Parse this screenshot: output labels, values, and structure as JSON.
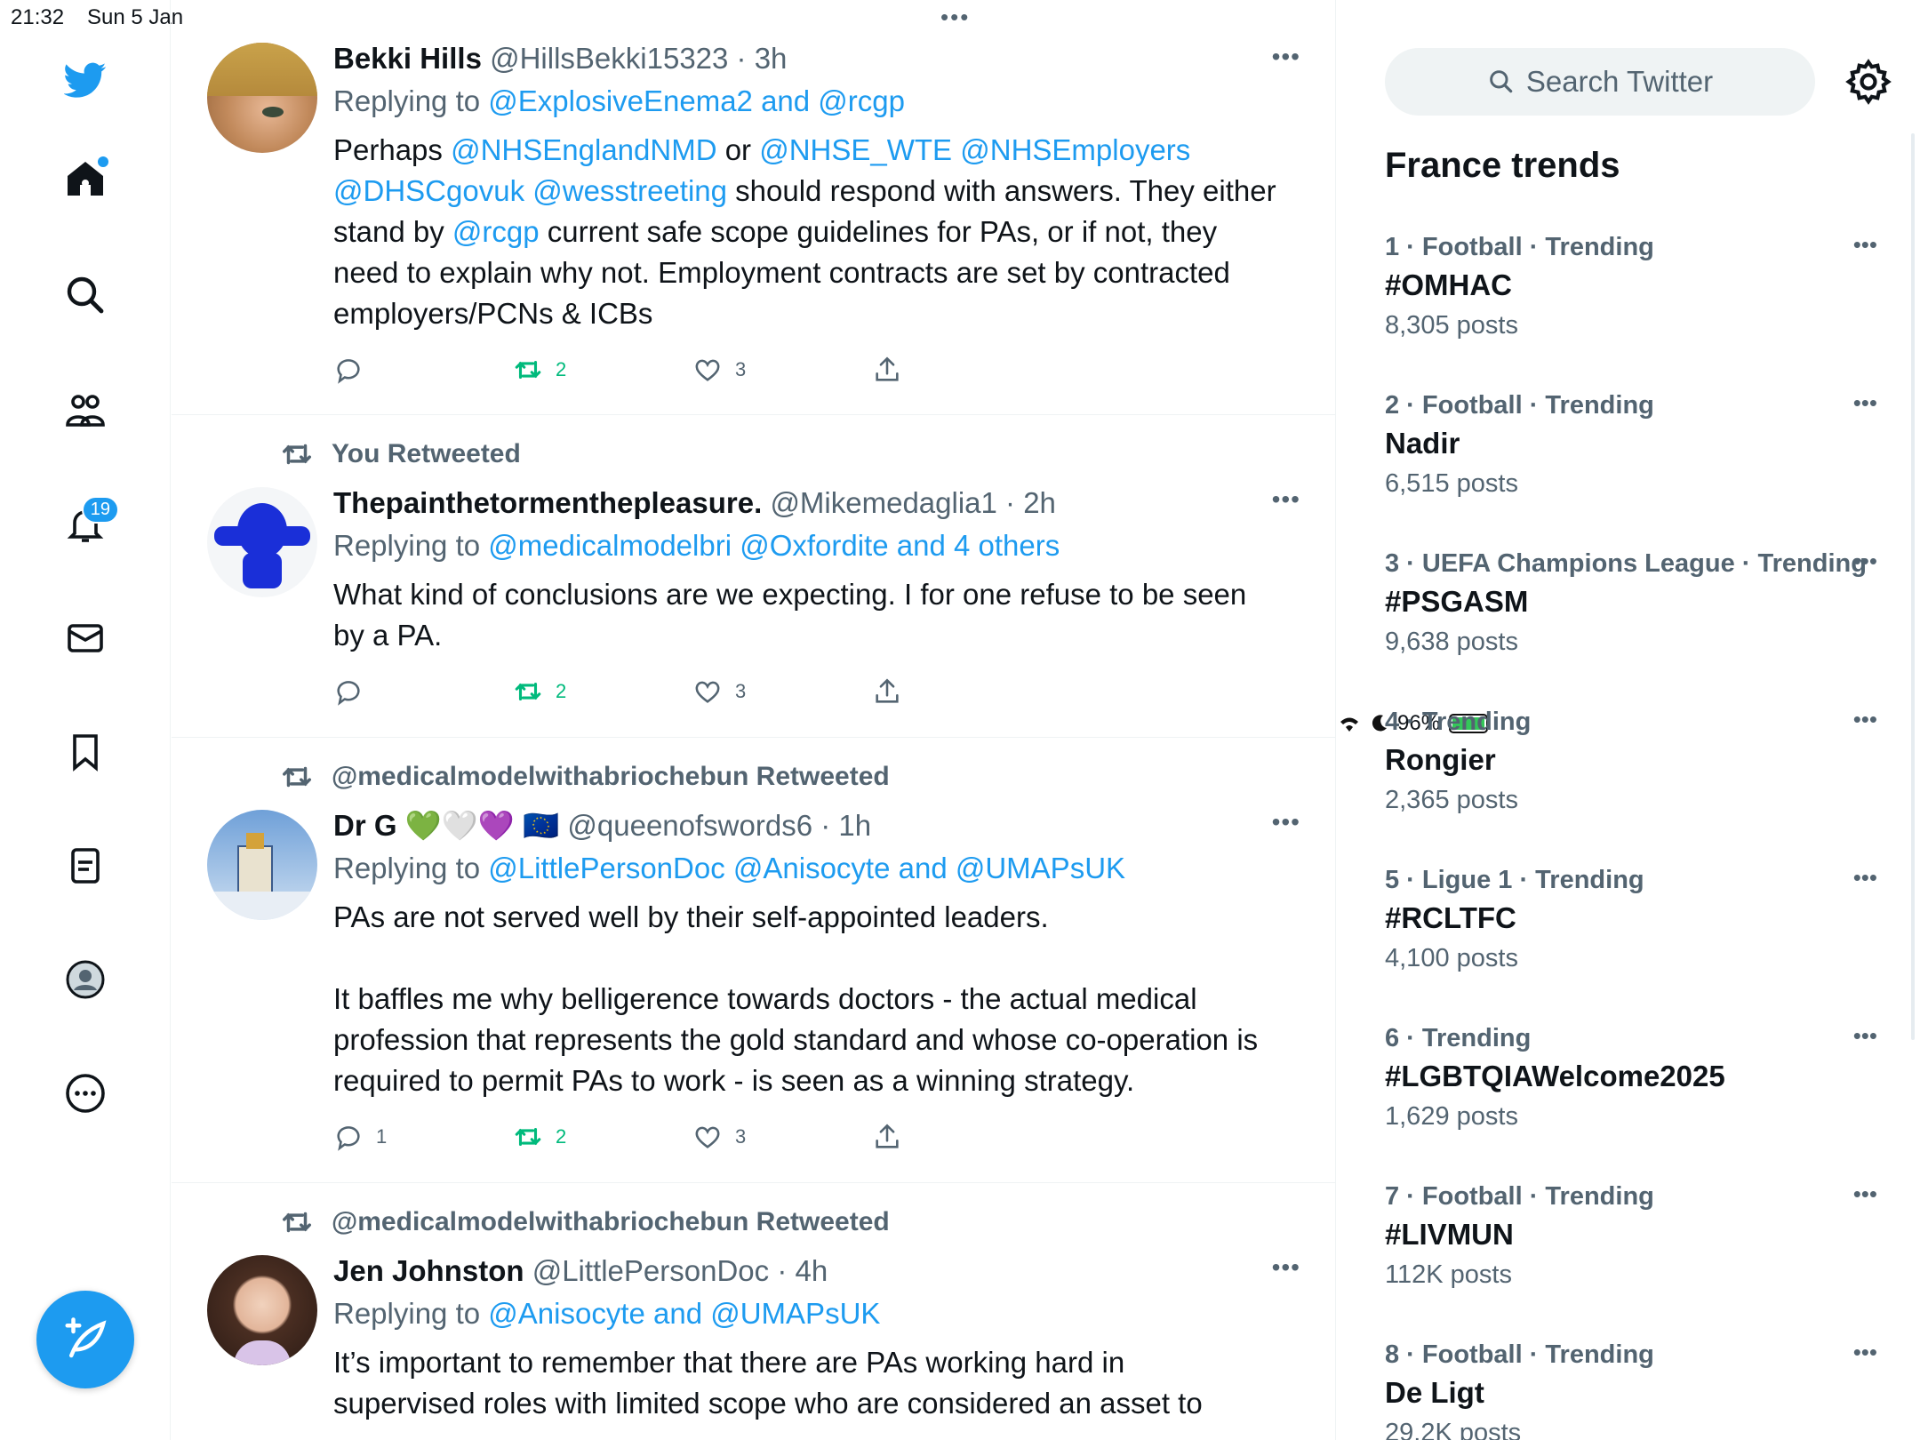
{
  "status_bar": {
    "time": "21:32",
    "date": "Sun 5 Jan",
    "battery": "96%"
  },
  "nav": {
    "notifications_badge": "19"
  },
  "search": {
    "placeholder": "Search Twitter"
  },
  "trends": {
    "title": "France trends",
    "items": [
      {
        "meta": "1 · Football · Trending",
        "topic": "#OMHAC",
        "count": "8,305 posts"
      },
      {
        "meta": "2 · Football · Trending",
        "topic": "Nadir",
        "count": "6,515 posts"
      },
      {
        "meta": "3 · UEFA Champions League · Trending",
        "topic": "#PSGASM",
        "count": "9,638 posts"
      },
      {
        "meta": "4 · Trending",
        "topic": "Rongier",
        "count": "2,365 posts"
      },
      {
        "meta": "5 · Ligue 1 · Trending",
        "topic": "#RCLTFC",
        "count": "4,100 posts"
      },
      {
        "meta": "6 · Trending",
        "topic": "#LGBTQIAWelcome2025",
        "count": "1,629 posts"
      },
      {
        "meta": "7 · Football · Trending",
        "topic": "#LIVMUN",
        "count": "112K posts"
      },
      {
        "meta": "8 · Football · Trending",
        "topic": "De Ligt",
        "count": "29.2K posts"
      }
    ]
  },
  "tweets": [
    {
      "retweet_context": "",
      "name": "Bekki Hills",
      "handle_time": "@HillsBekki15323 · 3h",
      "reply_prefix": "Replying to ",
      "reply_to": "@ExplosiveEnema2 and @rcgp",
      "body": [
        {
          "t": "Perhaps ",
          "l": "@NHSEnglandNMD",
          "t2": " or ",
          "l2": "@NHSE_WTE  @NHSEmployers"
        },
        {
          "l": "@DHSCgovuk @wesstreeting",
          "t": " should respond with answers. They either"
        },
        {
          "t": "stand by ",
          "l": "@rcgp",
          "t2": " current safe scope guidelines for PAs, or if not, they"
        },
        {
          "t": "need to explain why not. Employment contracts are set by contracted"
        },
        {
          "t": "employers/PCNs & ICBs"
        }
      ],
      "replies": "",
      "retweets": "2",
      "likes": "3"
    },
    {
      "retweet_context": "You Retweeted",
      "name": "Thepainthetormenthepleasure.",
      "handle_time": "@Mikemedaglia1 · 2h",
      "reply_prefix": "Replying to ",
      "reply_to": "@medicalmodelbri @Oxfordite and 4 others",
      "body_lines": [
        "What kind of conclusions are we expecting. I for one refuse to be seen",
        "by a PA."
      ],
      "replies": "",
      "retweets": "2",
      "likes": "3"
    },
    {
      "retweet_context": "@medicalmodelwithabriochebun Retweeted",
      "name": "Dr G",
      "emoji": "💚🤍💜 🇪🇺",
      "handle_time": "@queenofswords6 · 1h",
      "reply_prefix": "Replying to ",
      "reply_to": "@LittlePersonDoc @Anisocyte and @UMAPsUK",
      "body_lines": [
        "PAs are not served well by their self-appointed leaders.",
        "",
        "It baffles me why belligerence towards doctors - the actual medical",
        "profession that represents the gold standard and whose co-operation is",
        "required to permit PAs to work - is seen as a winning strategy."
      ],
      "replies": "1",
      "retweets": "2",
      "likes": "3"
    },
    {
      "retweet_context": "@medicalmodelwithabriochebun Retweeted",
      "name": "Jen Johnston",
      "handle_time": "@LittlePersonDoc · 4h",
      "reply_prefix": "Replying to ",
      "reply_to": "@Anisocyte and @UMAPsUK",
      "body_lines": [
        "It’s important to remember that there are PAs working hard in",
        "supervised roles with limited scope who are considered an asset to"
      ]
    }
  ],
  "colors": {
    "accent": "#1d9bf0",
    "retweet": "#00ba7c",
    "muted": "#536471"
  }
}
